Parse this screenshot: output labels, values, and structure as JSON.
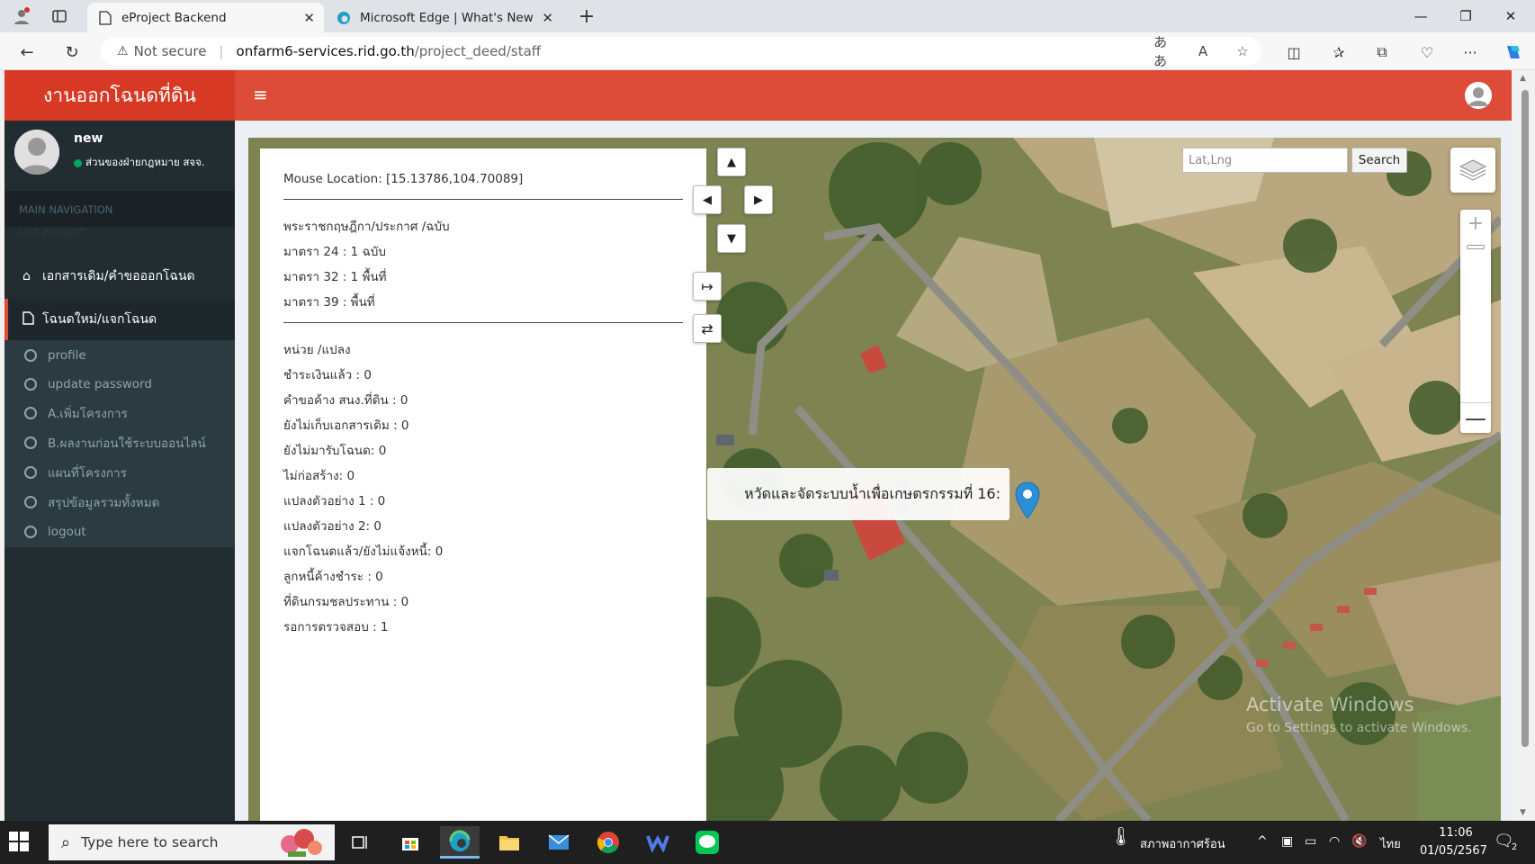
{
  "browser": {
    "tabs": [
      {
        "title": "eProject Backend",
        "active": true
      },
      {
        "title": "Microsoft Edge | What's New",
        "active": false
      }
    ],
    "security_label": "Not secure",
    "url_host": "onfarm6-services.rid.go.th",
    "url_path": "/project_deed/staff"
  },
  "app": {
    "brand": "งานออกโฉนดที่ดิน",
    "accent_color": "#dd4b39"
  },
  "sidebar": {
    "user_name": "new",
    "user_status": "ส่วนของฝ่ายกฎหมาย สจจ.",
    "header": "MAIN NAVIGATION",
    "ghost": "LIST PROJECT",
    "items": [
      {
        "label": "เอกสารเดิม/คำขอออกโฉนด",
        "icon": "home-icon"
      },
      {
        "label": "โฉนดใหม่/แจกโฉนด",
        "icon": "file-icon"
      }
    ],
    "sub_items": [
      "profile",
      "update password",
      "A.เพิ่มโครงการ",
      "B.ผลงานก่อนใช้ระบบออนไลน์",
      "แผนที่โครงการ",
      "สรุปข้อมูลรวมทั้งหมด",
      "logout"
    ]
  },
  "map": {
    "mouse_location": "Mouse Location: [15.13786,104.70089]",
    "section1": [
      "พระราชกฤษฎีกา/ประกาศ /ฉบับ",
      "มาตรา 24 : 1 ฉบับ",
      "มาตรา 32 : 1 พื้นที่",
      "มาตรา 39 : พื้นที่"
    ],
    "section2": [
      "หน่วย /แปลง",
      "ชำระเงินแล้ว : 0",
      "คำขอค้าง สนง.ที่ดิน : 0",
      "ยังไม่เก็บเอกสารเดิม : 0",
      "ยังไม่มารับโฉนด: 0",
      "ไม่ก่อสร้าง: 0",
      "แปลงตัวอย่าง 1 : 0",
      "แปลงตัวอย่าง 2: 0",
      "แจกโฉนดแล้ว/ยังไม่แจ้งหนี้: 0",
      "ลูกหนี้ค้างชำระ : 0",
      "ที่ดินกรมชลประทาน : 0",
      "รอการตรวจสอบ : 1"
    ],
    "popup_label": "หวัดและจัดระบบน้ำเพื่อเกษตรกรรมที่ 16:",
    "search_placeholder": "Lat,Lng",
    "search_button": "Search",
    "watermark_title": "Activate Windows",
    "watermark_sub": "Go to Settings to activate Windows."
  },
  "taskbar": {
    "search_placeholder": "Type here to search",
    "weather": "สภาพอากาศร้อน",
    "lang": "ไทย",
    "time": "11:06",
    "date": "01/05/2567",
    "notif_count": "2"
  }
}
